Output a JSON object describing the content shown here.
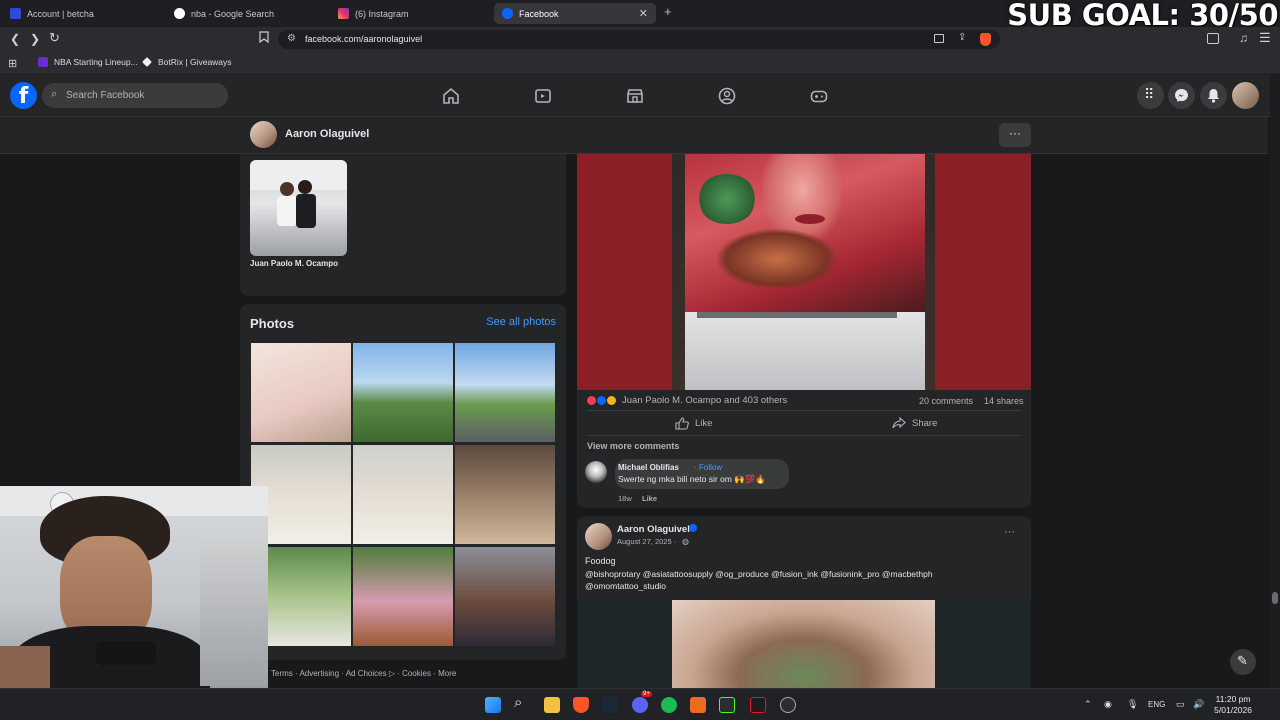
{
  "overlay": {
    "sub_goal": "SUB GOAL: 30/50"
  },
  "browser": {
    "tabs": [
      {
        "label": "Account | betcha",
        "icon": "betcha-icon",
        "color": "#2d4bd6"
      },
      {
        "label": "nba - Google Search",
        "icon": "google-icon",
        "color": "#e8e8e8"
      },
      {
        "label": "(6) Instagram",
        "icon": "instagram-icon",
        "color": "#e1306c"
      },
      {
        "label": "Facebook",
        "icon": "facebook-icon",
        "color": "#0866ff"
      }
    ],
    "new_tab": "+",
    "url": "facebook.com/aaronolaguivel",
    "bookmarks": [
      {
        "label": "NBA Starting Lineup...",
        "icon": "nba-bookmark-icon"
      },
      {
        "label": "BotRix | Giveaways",
        "icon": "botrix-bookmark-icon"
      }
    ]
  },
  "facebook": {
    "logo": "f",
    "search_placeholder": "Search Facebook",
    "nav_icons": [
      "home-icon",
      "video-icon",
      "marketplace-icon",
      "groups-icon",
      "gaming-icon"
    ],
    "profile_bar": {
      "name": "Aaron Olaguivel",
      "more": "···"
    },
    "friend": {
      "name": "Juan Paolo M. Ocampo"
    },
    "photos": {
      "title": "Photos",
      "see_all": "See all photos"
    },
    "footer": "Terms · Advertising · Ad Choices ▷ · Cookies · More",
    "post1": {
      "reactions_text": "Juan Paolo M. Ocampo and 403 others",
      "comments": "20 comments",
      "shares": "14 shares",
      "like_label": "Like",
      "share_label": "Share",
      "view_more": "View more comments",
      "comment": {
        "author": "Michael Oblifias",
        "follow": "Follow",
        "text": "Swerte ng mka bili neto sir om 🙌💯🔥",
        "time": "18w",
        "like": "Like"
      }
    },
    "post2": {
      "author": "Aaron Olaguivel",
      "date": "August 27, 2025 · ",
      "text": "Foodog",
      "tags_line1": "@bishoprotary  @asiatattoosupply  @og_produce  @fusion_ink @fusionink_pro @macbethph",
      "tags_line2": "@omomtattoo_studio",
      "more": "···"
    }
  },
  "taskbar": {
    "language": "ENG",
    "time": "11:20 pm",
    "date": "5/01/2026",
    "discord_badge": "9+"
  }
}
